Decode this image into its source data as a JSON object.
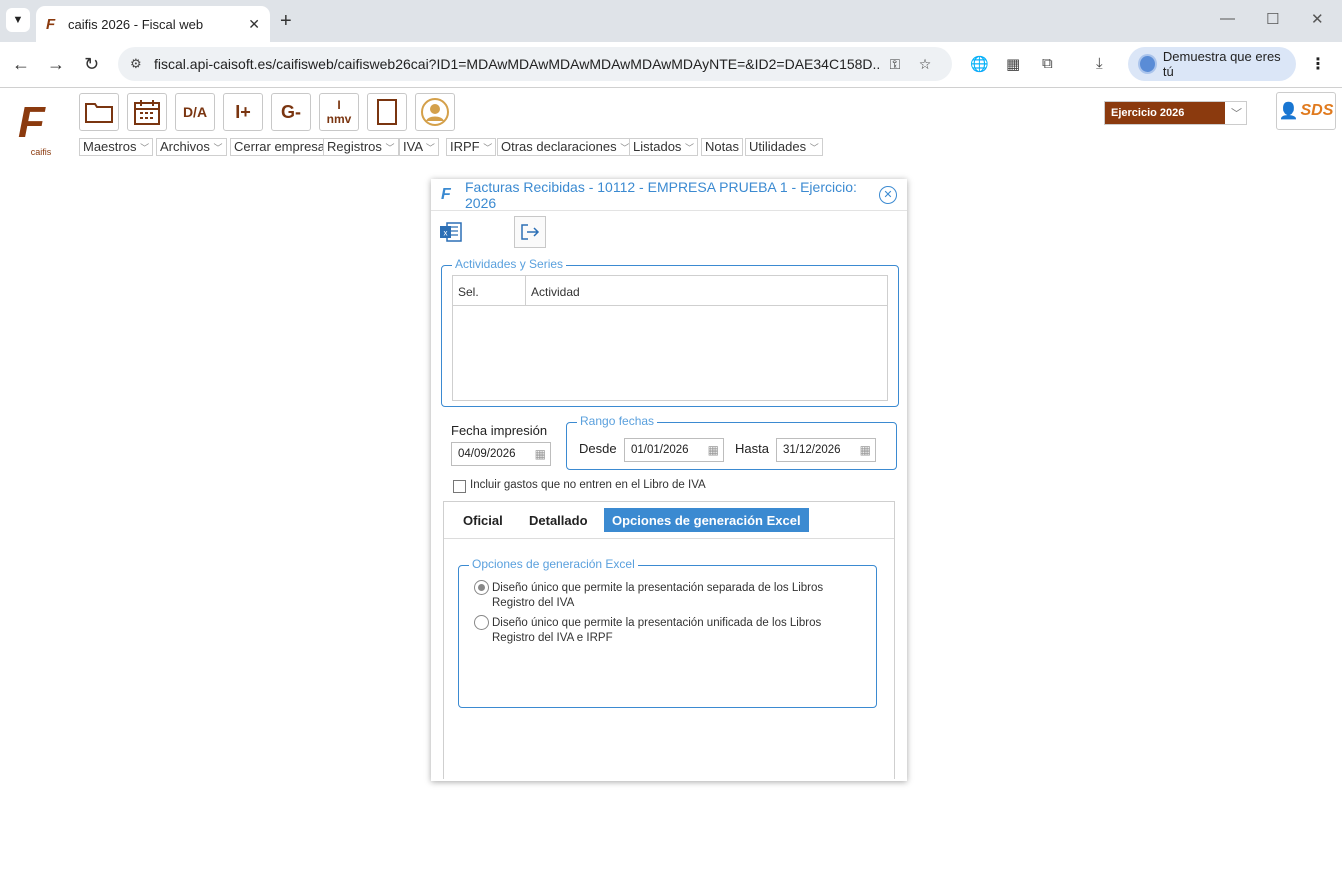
{
  "browser": {
    "tab_title": "caifis 2026 - Fiscal web",
    "url": "fiscal.api-caisoft.es/caifisweb/caifisweb26cai?ID1=MDAwMDAwMDAwMDAwMDAwMDAyNTE=&ID2=DAE34C158D...",
    "profile_label": "Demuestra que eres tú"
  },
  "app": {
    "logo_caption": "caifis",
    "toolbar_glyphs": [
      "D/A",
      "I+",
      "G-",
      "I nmv"
    ],
    "menus": [
      "Maestros",
      "Archivos",
      "Cerrar empresa",
      "Registros",
      "IVA",
      "IRPF",
      "Otras declaraciones",
      "Listados",
      "Notas",
      "Utilidades"
    ],
    "ejercicio": "Ejercicio 2026",
    "sds_label": "SDS",
    "brand_color": "#8b3a0e",
    "accent_color": "#3b8ad1"
  },
  "dialog": {
    "title": "Facturas Recibidas - 10112 - EMPRESA PRUEBA 1 - Ejercicio: 2026",
    "actividades_legend": "Actividades y Series",
    "col_sel": "Sel.",
    "col_actividad": "Actividad",
    "fecha_impresion_label": "Fecha impresión",
    "fecha_impresion_value": "04/09/2026",
    "rango_legend": "Rango fechas",
    "desde_label": "Desde",
    "desde_value": "01/01/2026",
    "hasta_label": "Hasta",
    "hasta_value": "31/12/2026",
    "incluir_gastos_label": "Incluir gastos que no entren en el Libro de IVA",
    "tabs": [
      "Oficial",
      "Detallado",
      "Opciones de generación Excel"
    ],
    "excel_legend": "Opciones de generación Excel",
    "option1": "Diseño único que permite la presentación separada de los Libros Registro del IVA",
    "option2": "Diseño único que permite la presentación unificada de los Libros Registro del IVA e IRPF"
  }
}
